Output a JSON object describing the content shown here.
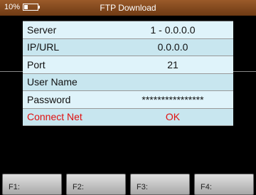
{
  "status": {
    "battery_percent_label": "10%",
    "battery_level": 0.3
  },
  "titlebar": {
    "title": "FTP Download"
  },
  "settings": [
    {
      "label": "Server",
      "value": "1 - 0.0.0.0"
    },
    {
      "label": "IP/URL",
      "value": "0.0.0.0"
    },
    {
      "label": "Port",
      "value": "21"
    },
    {
      "label": "User Name",
      "value": ""
    },
    {
      "label": "Password",
      "value": "****************"
    },
    {
      "label": "Connect Net",
      "value": "OK"
    }
  ],
  "function_keys": [
    {
      "label": "F1:"
    },
    {
      "label": "F2:"
    },
    {
      "label": "F3:"
    },
    {
      "label": "F4:"
    }
  ],
  "colors": {
    "accent": "#e01010",
    "titlebar": "#7a4420",
    "row_light": "#dff3fa",
    "row_dark": "#c8e6ef"
  }
}
